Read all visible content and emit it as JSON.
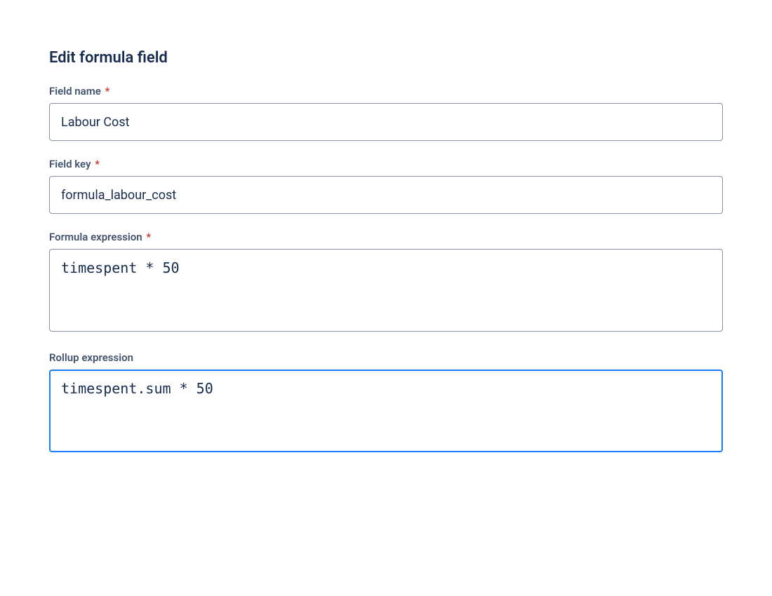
{
  "heading": "Edit formula field",
  "fields": {
    "fieldName": {
      "label": "Field name",
      "required": true,
      "value": "Labour Cost"
    },
    "fieldKey": {
      "label": "Field key",
      "required": true,
      "value": "formula_labour_cost"
    },
    "formulaExpression": {
      "label": "Formula expression",
      "required": true,
      "value": "timespent * 50"
    },
    "rollupExpression": {
      "label": "Rollup expression",
      "required": false,
      "value": "timespent.sum * 50"
    }
  },
  "requiredMark": "*"
}
